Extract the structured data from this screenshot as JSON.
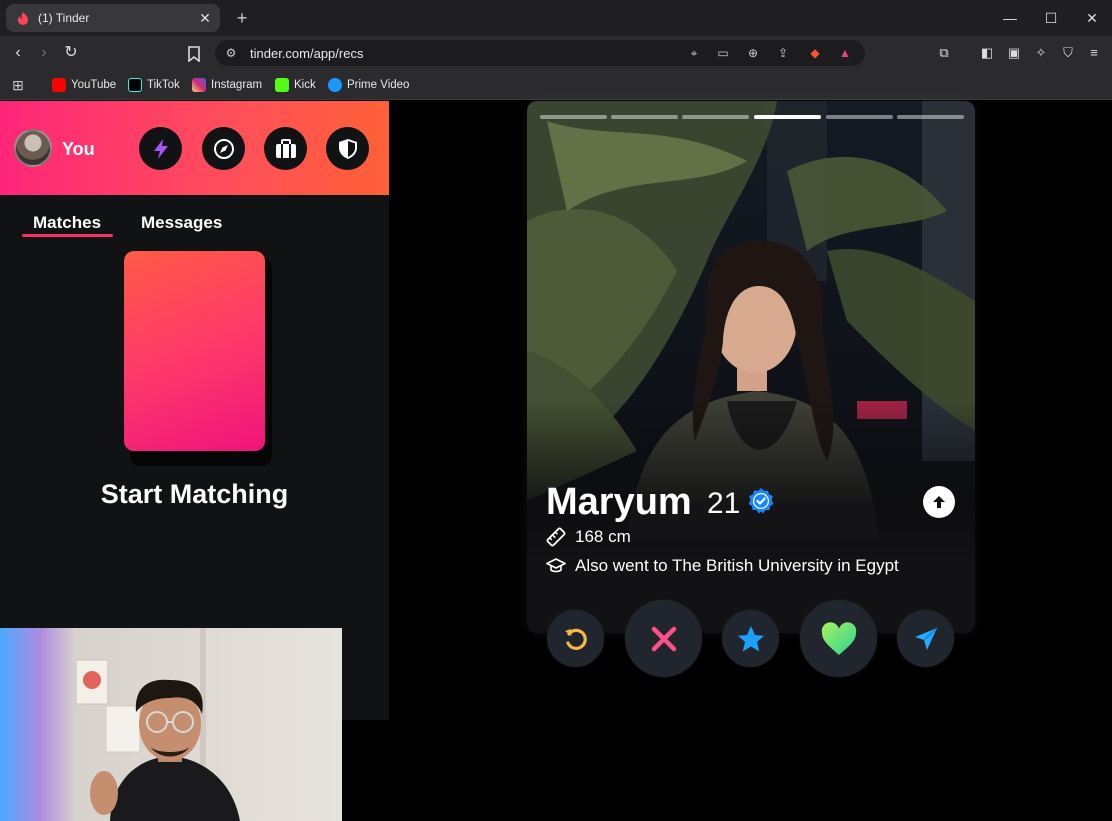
{
  "browser": {
    "tab_title": "(1) Tinder",
    "url": "tinder.com/app/recs",
    "bookmarks": [
      {
        "label": "YouTube",
        "color": "#ff0000"
      },
      {
        "label": "TikTok",
        "color": "#111111"
      },
      {
        "label": "Instagram",
        "color": "#d62976"
      },
      {
        "label": "Kick",
        "color": "#53fc18"
      },
      {
        "label": "Prime Video",
        "color": "#1a98ff"
      }
    ]
  },
  "sidebar": {
    "profile_label": "You",
    "header_buttons": [
      "boost-icon",
      "explore-compass-icon",
      "passport-briefcase-icon",
      "safety-shield-icon"
    ],
    "tabs": [
      {
        "label": "Matches",
        "active": true
      },
      {
        "label": "Messages",
        "active": false
      }
    ],
    "empty_state_title": "Start Matching"
  },
  "profile": {
    "name": "Maryum",
    "age": "21",
    "verified": true,
    "height": "168 cm",
    "school": "Also went to The British University in Egypt",
    "photo_count": 6,
    "active_photo": 4
  },
  "actions": [
    "rewind-icon",
    "nope-icon",
    "super-like-icon",
    "like-icon",
    "boost-icon"
  ],
  "colors": {
    "brand_gradient_start": "#fd267a",
    "brand_gradient_end": "#ff6036",
    "rewind": "#f5b748",
    "nope": "#ff4f8b",
    "super_like": "#1aa0ff",
    "like": "#4ce08a",
    "boost": "#26a8ff"
  }
}
